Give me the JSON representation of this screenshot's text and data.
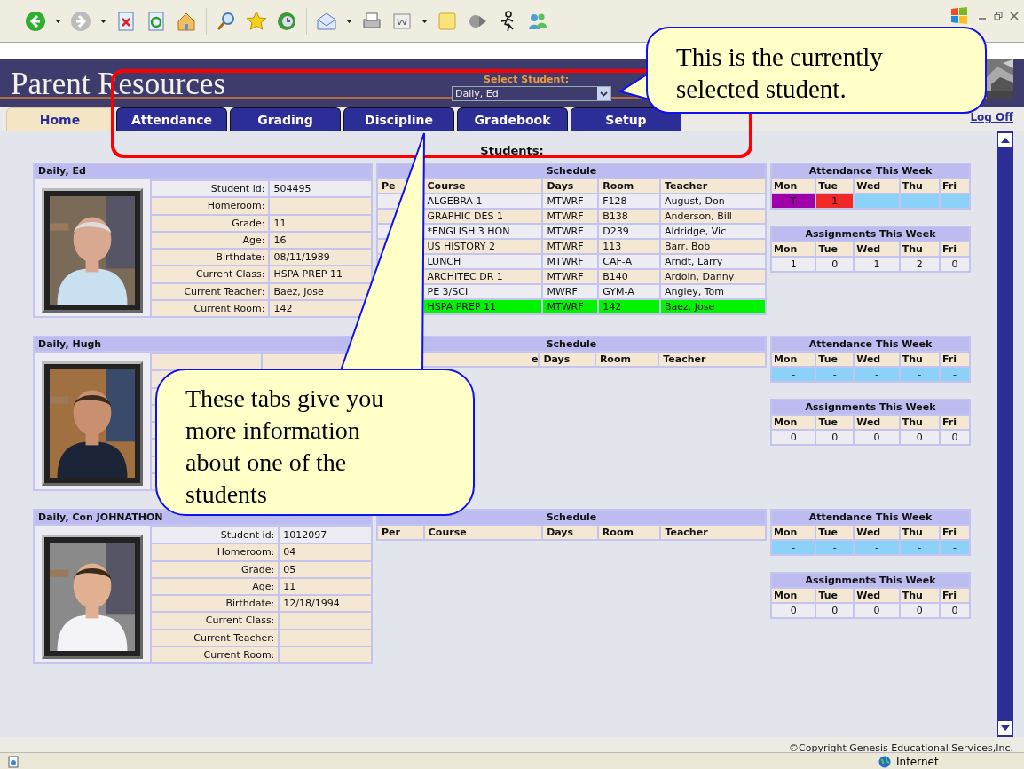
{
  "header": {
    "title": "Parent Resources",
    "select_label": "Select Student:",
    "select_value": "Daily, Ed"
  },
  "tabs": [
    {
      "label": "Home",
      "selected": true
    },
    {
      "label": "Attendance",
      "selected": false
    },
    {
      "label": "Grading",
      "selected": false
    },
    {
      "label": "Discipline",
      "selected": false
    },
    {
      "label": "Gradebook",
      "selected": false
    },
    {
      "label": "Setup",
      "selected": false
    }
  ],
  "log_off": "Log Off",
  "section_title": "Students:",
  "students": [
    {
      "name": "Daily, Ed",
      "info": [
        {
          "label": "Student id:",
          "value": "504495"
        },
        {
          "label": "Homeroom:"
        },
        {
          "label": "Grade:",
          "value": "11"
        },
        {
          "label": "Age:",
          "value": "16"
        },
        {
          "label": "Birthdate:",
          "value": "08/11/1989"
        },
        {
          "label": "Current Class:",
          "value": "HSPA PREP 11"
        },
        {
          "label": "Current Teacher:",
          "value": "Baez, Jose"
        },
        {
          "label": "Current Room:",
          "value": "142"
        }
      ],
      "schedule": {
        "title": "Schedule",
        "columns": [
          "Pe",
          "Course",
          "Days",
          "Room",
          "Teacher"
        ],
        "rows": [
          {
            "course": "ALGEBRA 1",
            "days": "MTWRF",
            "room": "F128",
            "teacher": "August, Don",
            "highlighted": false
          },
          {
            "course": "GRAPHIC DES 1",
            "days": "MTWRF",
            "room": "B138",
            "teacher": "Anderson, Bill",
            "highlighted": false
          },
          {
            "course": "*ENGLISH 3 HON",
            "days": "MTWRF",
            "room": "D239",
            "teacher": "Aldridge, Vic",
            "highlighted": false
          },
          {
            "course": "US HISTORY 2",
            "days": "MTWRF",
            "room": "113",
            "teacher": "Barr, Bob",
            "highlighted": false
          },
          {
            "course": "LUNCH",
            "days": "MTWRF",
            "room": "CAF-A",
            "teacher": "Arndt, Larry",
            "highlighted": false
          },
          {
            "course": "ARCHITEC DR 1",
            "days": "MTWRF",
            "room": "B140",
            "teacher": "Ardoin, Danny",
            "highlighted": false
          },
          {
            "course": "PE 3/SCI",
            "days": "MWRF",
            "room": "GYM-A",
            "teacher": "Angley, Tom",
            "highlighted": false
          },
          {
            "course": "HSPA PREP 11",
            "days": "MTWRF",
            "room": "142",
            "teacher": "Baez, Jose",
            "highlighted": true
          }
        ]
      },
      "attendance": {
        "title": "Attendance This Week",
        "days": [
          "Mon",
          "Tue",
          "Wed",
          "Thu",
          "Fri"
        ],
        "cells": [
          {
            "text": "T",
            "color": "#a000a8"
          },
          {
            "text": "1",
            "color": "#f02828"
          },
          {
            "text": "-",
            "color": "#8cd2f8"
          },
          {
            "text": "-",
            "color": "#8cd2f8"
          },
          {
            "text": "-",
            "color": "#8cd2f8"
          }
        ]
      },
      "assignments": {
        "title": "Assignments This Week",
        "days": [
          "Mon",
          "Tue",
          "Wed",
          "Thu",
          "Fri"
        ],
        "counts": [
          "1",
          "0",
          "1",
          "2",
          "0"
        ]
      }
    },
    {
      "name": "Daily, Hugh",
      "schedule": {
        "title": "Schedule",
        "columns": [
          "e",
          "Days",
          "Room",
          "Teacher"
        ]
      },
      "attendance": {
        "title": "Attendance This Week",
        "days": [
          "Mon",
          "Tue",
          "Wed",
          "Thu",
          "Fri"
        ],
        "cells": [
          {
            "text": "-",
            "color": "#8cd2f8"
          },
          {
            "text": "-",
            "color": "#8cd2f8"
          },
          {
            "text": "-",
            "color": "#8cd2f8"
          },
          {
            "text": "-",
            "color": "#8cd2f8"
          },
          {
            "text": "-",
            "color": "#8cd2f8"
          }
        ]
      },
      "assignments": {
        "title": "Assignments This Week",
        "days": [
          "Mon",
          "Tue",
          "Wed",
          "Thu",
          "Fri"
        ],
        "counts": [
          "0",
          "0",
          "0",
          "0",
          "0"
        ]
      }
    },
    {
      "name": "Daily, Con JOHNATHON",
      "info": [
        {
          "label": "Student id:",
          "value": "1012097"
        },
        {
          "label": "Homeroom:",
          "value": "04"
        },
        {
          "label": "Grade:",
          "value": "05"
        },
        {
          "label": "Age:",
          "value": "11"
        },
        {
          "label": "Birthdate:",
          "value": "12/18/1994"
        },
        {
          "label": "Current Class:"
        },
        {
          "label": "Current Teacher:"
        },
        {
          "label": "Current Room:"
        }
      ],
      "schedule": {
        "title": "Schedule",
        "columns": [
          "Per",
          "Course",
          "Days",
          "Room",
          "Teacher"
        ]
      },
      "attendance": {
        "title": "Attendance This Week",
        "days": [
          "Mon",
          "Tue",
          "Wed",
          "Thu",
          "Fri"
        ],
        "cells": [
          {
            "text": "-",
            "color": "#8cd2f8"
          },
          {
            "text": "-",
            "color": "#8cd2f8"
          },
          {
            "text": "-",
            "color": "#8cd2f8"
          },
          {
            "text": "-",
            "color": "#8cd2f8"
          },
          {
            "text": "-",
            "color": "#8cd2f8"
          }
        ]
      },
      "assignments": {
        "title": "Assignments This Week",
        "days": [
          "Mon",
          "Tue",
          "Wed",
          "Thu",
          "Fri"
        ],
        "counts": [
          "0",
          "0",
          "0",
          "0",
          "0"
        ]
      }
    }
  ],
  "copyright": "©Copyright Genesis Educational Services,Inc.",
  "status_bar": {
    "zone": "Internet"
  },
  "callouts": [
    {
      "text": "This is the currently selected student."
    },
    {
      "text": "These tabs give you more information about one of the students"
    }
  ]
}
